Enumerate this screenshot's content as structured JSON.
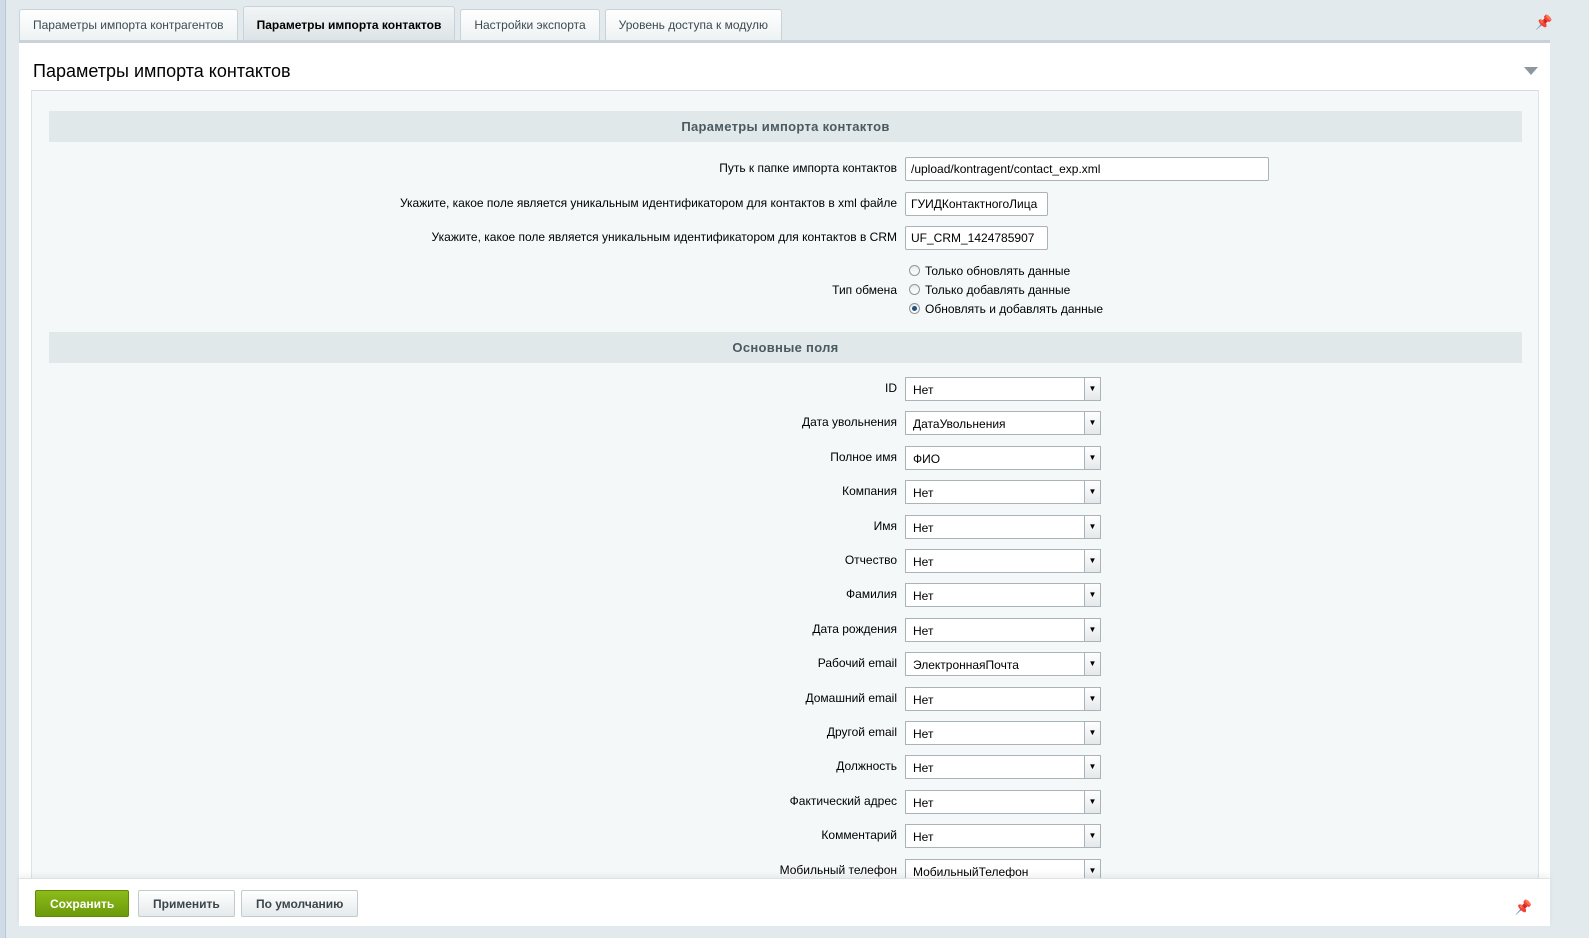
{
  "tabs": [
    {
      "label": "Параметры импорта контрагентов"
    },
    {
      "label": "Параметры импорта контактов",
      "active": true
    },
    {
      "label": "Настройки экспорта"
    },
    {
      "label": "Уровень доступа к модулю"
    }
  ],
  "panel": {
    "title": "Параметры импорта контактов"
  },
  "section1": {
    "title": "Параметры импорта контактов",
    "path": {
      "label": "Путь к папке импорта контактов",
      "value": "/upload/kontragent/contact_exp.xml"
    },
    "xml_id": {
      "label": "Укажите, какое поле является уникальным идентификатором для контактов в xml файле",
      "value": "ГУИДКонтактногоЛица"
    },
    "crm_id": {
      "label": "Укажите, какое поле является уникальным идентификатором для контактов в CRM",
      "value": "UF_CRM_1424785907"
    },
    "exchange": {
      "label": "Тип обмена",
      "options": [
        "Только обновлять данные",
        "Только добавлять данные",
        "Обновлять и добавлять данные"
      ],
      "selected": 2
    }
  },
  "section2": {
    "title": "Основные поля",
    "fields": [
      {
        "label": "ID",
        "value": "Нет"
      },
      {
        "label": "Дата увольнения",
        "value": "ДатаУвольнения"
      },
      {
        "label": "Полное имя",
        "value": "ФИО"
      },
      {
        "label": "Компания",
        "value": "Нет"
      },
      {
        "label": "Имя",
        "value": "Нет"
      },
      {
        "label": "Отчество",
        "value": "Нет"
      },
      {
        "label": "Фамилия",
        "value": "Нет"
      },
      {
        "label": "Дата рождения",
        "value": "Нет"
      },
      {
        "label": "Рабочий email",
        "value": "ЭлектроннаяПочта"
      },
      {
        "label": "Домашний email",
        "value": "Нет"
      },
      {
        "label": "Другой email",
        "value": "Нет"
      },
      {
        "label": "Должность",
        "value": "Нет"
      },
      {
        "label": "Фактический адрес",
        "value": "Нет"
      },
      {
        "label": "Комментарий",
        "value": "Нет"
      },
      {
        "label": "Мобильный телефон",
        "value": "МобильныйТелефон"
      }
    ]
  },
  "footer": {
    "save": "Сохранить",
    "apply": "Применить",
    "default": "По умолчанию"
  },
  "colors": {
    "save_button": "#7aa812",
    "section_header": "#e0e8ea"
  }
}
